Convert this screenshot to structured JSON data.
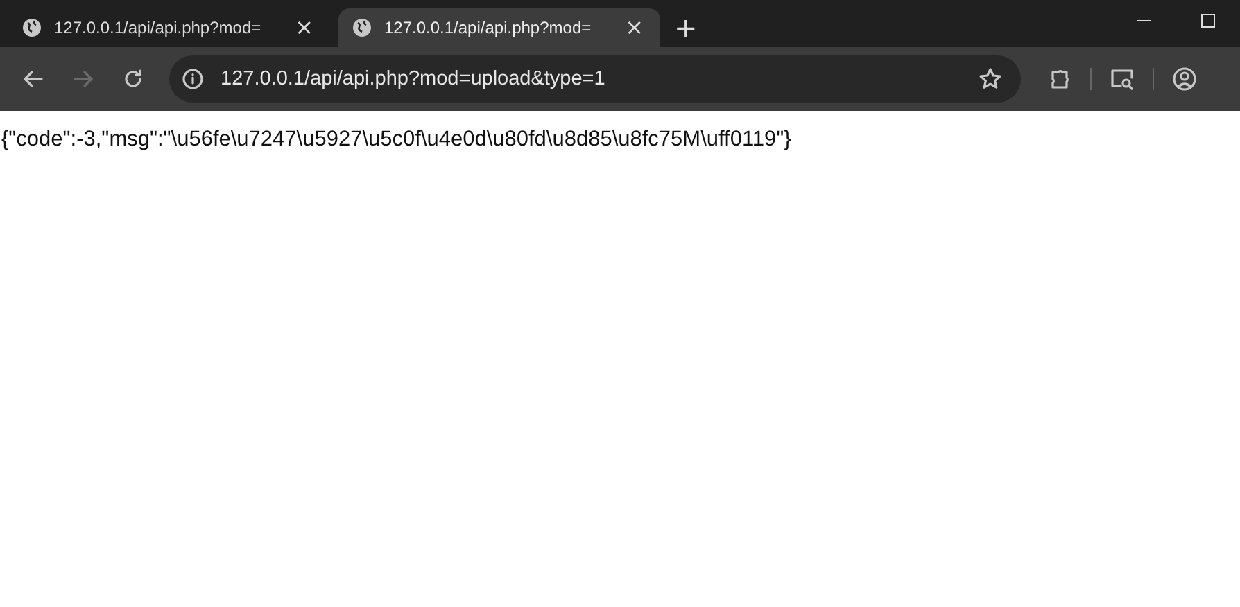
{
  "tabs": [
    {
      "title": "127.0.0.1/api/api.php?mod=",
      "selected": false,
      "close": "×"
    },
    {
      "title": "127.0.0.1/api/api.php?mod=",
      "selected": true,
      "close": "×"
    }
  ],
  "new_tab": "+",
  "address_bar": {
    "url": "127.0.0.1/api/api.php?mod=upload&type=1"
  },
  "navigation": {
    "forward_disabled": true
  },
  "page": {
    "body": "{\"code\":-3,\"msg\":\"\\u56fe\\u7247\\u5927\\u5c0f\\u4e0d\\u80fd\\u8d85\\u8fc75M\\uff0119\"}"
  }
}
